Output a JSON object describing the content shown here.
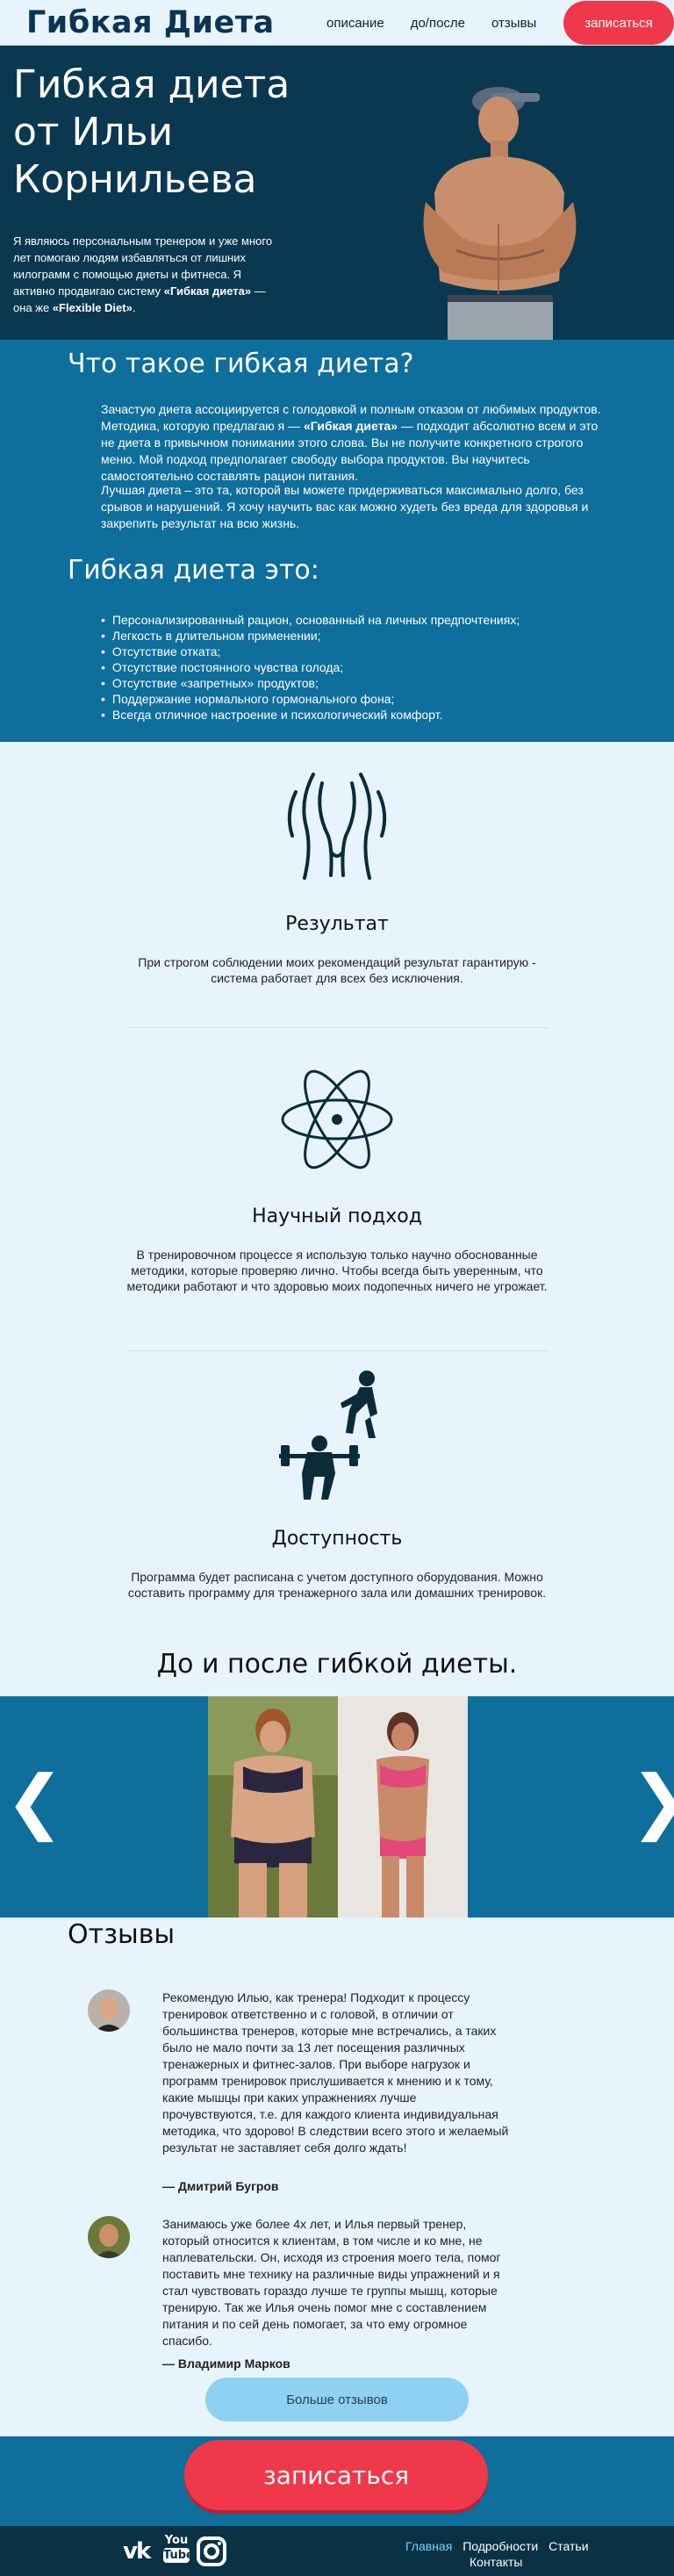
{
  "header": {
    "logo": "Гибкая Диета",
    "nav": [
      "описание",
      "до/после",
      "отзывы"
    ],
    "cta": "записаться"
  },
  "hero": {
    "title": "Гибкая диета от Ильи Корнильева",
    "text_part1": "Я являюсь персональным тренером и уже много лет помогаю людям избавляться от лишних килограмм с помощью диеты и фитнеса. Я активно продвигаю систему ",
    "text_bold1": "«Гибкая диета»",
    "text_part2": " — она же ",
    "text_bold2": "«Flexible Diet»",
    "text_part3": "."
  },
  "what": {
    "title": "Что такое гибкая диета?",
    "p1_a": "Зачастую диета ассоциируется с голодовкой и полным отказом от любимых продуктов. Методика, которую предлагаю я — ",
    "p1_bold": "«Гибкая диета»",
    "p1_b": " — подходит абсолютно всем и это не диета в привычном понимании этого слова. Вы не получите конкретного строгого меню. Мой подход предполагает свободу выбора продуктов. Вы научитесь самостоятельно составлять рацион питания.",
    "p2": "Лучшая диета – это та, которой вы можете придерживаться максимально долго, без срывов и нарушений. Я хочу научить вас как можно худеть без вреда для здоровья и закрепить результат на всю жизнь.",
    "subtitle": "Гибкая диета это:",
    "list": [
      "Персонализированный рацион, основанный на личных предпочтениях;",
      "Легкость в длительном применении;",
      "Отсутствие отката;",
      "Отсутствие постоянного чувства голода;",
      "Отсутствие «запретных» продуктов;",
      "Поддержание нормального гормонального фона;",
      "Всегда отличное настроение и психологический комфорт."
    ]
  },
  "features": [
    {
      "icon": "body-shape-icon",
      "title": "Результат",
      "text": "При строгом соблюдении моих рекомендаций результат гарантирую - система работает для всех без исключения."
    },
    {
      "icon": "atom-icon",
      "title": "Научный подход",
      "text": "В тренировочном процессе я использую только научно обоснованные методики, которые проверяю лично. Чтобы всегда быть уверенным, что методики работают и что здоровью моих подопечных ничего не угрожает."
    },
    {
      "icon": "workout-icon",
      "title": "Доступность",
      "text": "Программа будет расписана с учетом доступного оборудования. Можно составить программу для тренажерного зала или домашних тренировок."
    }
  ],
  "before_after": {
    "title": "До и после гибкой диеты.",
    "prev": "❮",
    "next": "❯"
  },
  "reviews": {
    "title": "Отзывы",
    "items": [
      {
        "text": "Рекомендую Илью, как тренера! Подходит к процессу тренировок ответственно и с головой, в отличии от большинства тренеров, которые мне встречались, а таких было не мало почти за 13 лет посещения различных тренажерных и фитнес-залов. При выборе нагрузок и программ тренировок прислушивается к мнению и к тому, какие мышцы при каких упражнениях лучше прочувствуются, т.е. для каждого клиента индивидуальная методика, что здорово! В следствии всего этого и желаемый результат не заставляет себя долго ждать!",
        "author": "— Дмитрий Бугров"
      },
      {
        "text": "Занимаюсь уже более 4х лет, и Илья первый тренер, который относится к клиентам, в том числе и ко мне, не наплевательски. Он, исходя из строения моего тела, помог поставить мне технику на различные виды упражнений и я стал чувствовать гораздо лучше те группы мышц, которые тренирую. Так же Илья очень помог мне с составлением питания и по сей день помогает, за что ему огромное спасибо.",
        "author": "— Владимир Марков"
      }
    ],
    "more": "Больше отзывов"
  },
  "cta": {
    "label": "записаться"
  },
  "footer": {
    "social": [
      "vk-icon",
      "youtube-icon",
      "instagram-icon"
    ],
    "vk": "vk",
    "yt_top": "You",
    "yt_bottom": "Tube",
    "links": [
      "Главная",
      "Подробности",
      "Статьи",
      "Контакты"
    ]
  },
  "colors": {
    "accent": "#f0384b",
    "dark": "#0a3850",
    "section": "#0e6e9c"
  }
}
